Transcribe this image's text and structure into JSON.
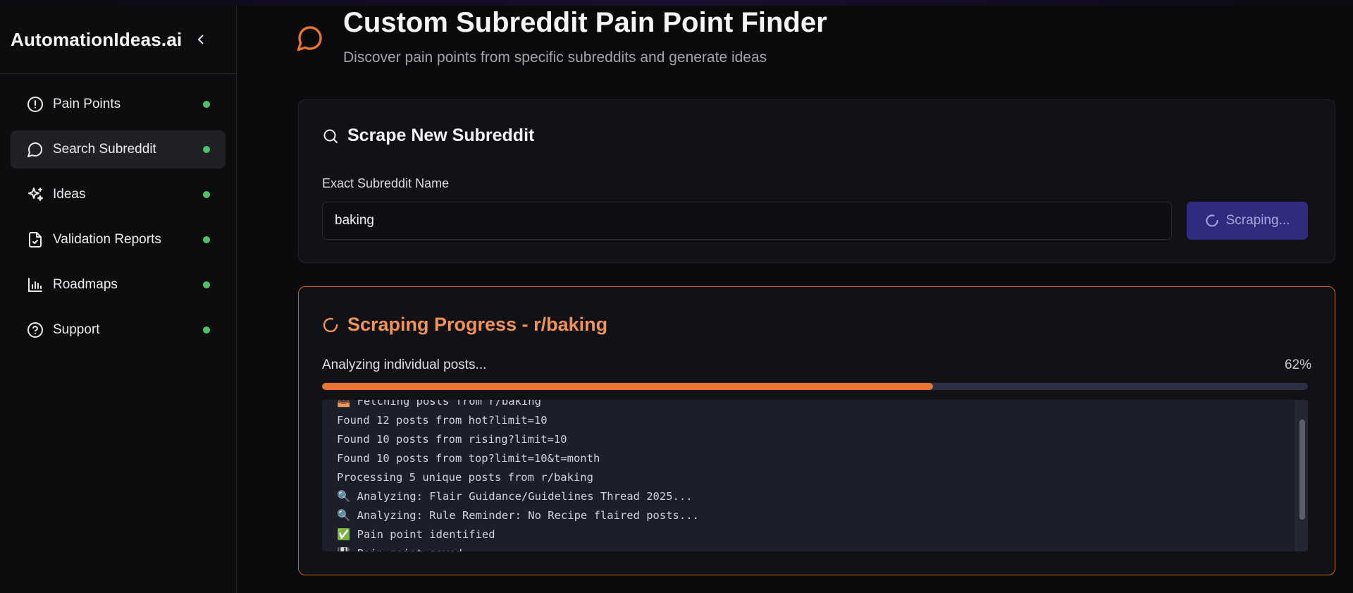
{
  "app": {
    "brand": "AutomationIdeas.ai"
  },
  "sidebar": {
    "items": [
      {
        "label": "Pain Points",
        "icon": "alert-circle-icon",
        "active": false
      },
      {
        "label": "Search Subreddit",
        "icon": "message-circle-icon",
        "active": true
      },
      {
        "label": "Ideas",
        "icon": "sparkles-icon",
        "active": false
      },
      {
        "label": "Validation Reports",
        "icon": "file-check-icon",
        "active": false
      },
      {
        "label": "Roadmaps",
        "icon": "bar-chart-icon",
        "active": false
      },
      {
        "label": "Support",
        "icon": "help-circle-icon",
        "active": false
      }
    ],
    "status_dot_color": "#4cc46a"
  },
  "header": {
    "title": "Custom Subreddit Pain Point Finder",
    "subtitle": "Discover pain points from specific subreddits and generate ideas"
  },
  "scrape_card": {
    "title": "Scrape New Subreddit",
    "field_label": "Exact Subreddit Name",
    "input_value": "baking",
    "button_label": "Scraping..."
  },
  "progress_card": {
    "title": "Scraping Progress - r/baking",
    "status": "Analyzing individual posts...",
    "percent_label": "62%",
    "percent_value": 0.62,
    "accent_color": "#e8752f",
    "log_lines": [
      "📥 Fetching posts from r/baking",
      "Found 12 posts from hot?limit=10",
      "Found 10 posts from rising?limit=10",
      "Found 10 posts from top?limit=10&t=month",
      "Processing 5 unique posts from r/baking",
      "🔍 Analyzing: Flair Guidance/Guidelines Thread 2025...",
      "🔍 Analyzing: Rule Reminder: No Recipe flaired posts...",
      "✅ Pain point identified",
      "💾 Pain point saved"
    ]
  }
}
